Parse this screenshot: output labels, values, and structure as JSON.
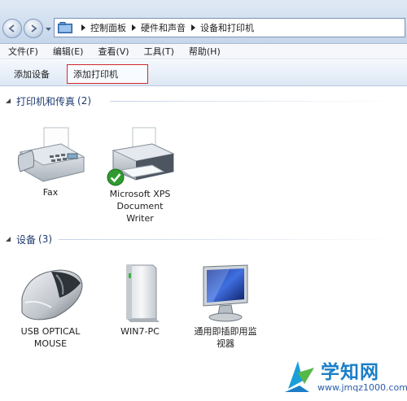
{
  "address_bar": {
    "breadcrumbs": [
      "控制面板",
      "硬件和声音",
      "设备和打印机"
    ]
  },
  "menu": {
    "items": [
      "文件(F)",
      "编辑(E)",
      "查看(V)",
      "工具(T)",
      "帮助(H)"
    ]
  },
  "command_bar": {
    "add_device": "添加设备",
    "add_printer": "添加打印机"
  },
  "groups": {
    "printers": {
      "title": "打印机和传真",
      "count": "(2)",
      "items": [
        {
          "label_lines": [
            "Fax"
          ]
        },
        {
          "label_lines": [
            "Microsoft XPS",
            "Document",
            "Writer"
          ],
          "default": true
        }
      ]
    },
    "devices": {
      "title": "设备",
      "count": "(3)",
      "items": [
        {
          "label_lines": [
            "USB OPTICAL",
            "MOUSE"
          ]
        },
        {
          "label_lines": [
            "WIN7-PC"
          ]
        },
        {
          "label_lines": [
            "通用即插即用监",
            "视器"
          ]
        }
      ]
    }
  },
  "watermark": {
    "title": "学知网",
    "url": "www.jmqz1000.com"
  },
  "colors": {
    "accent_red": "#d22a2a",
    "group_title": "#1e3a70",
    "watermark_blue": "#1b7ec7"
  }
}
